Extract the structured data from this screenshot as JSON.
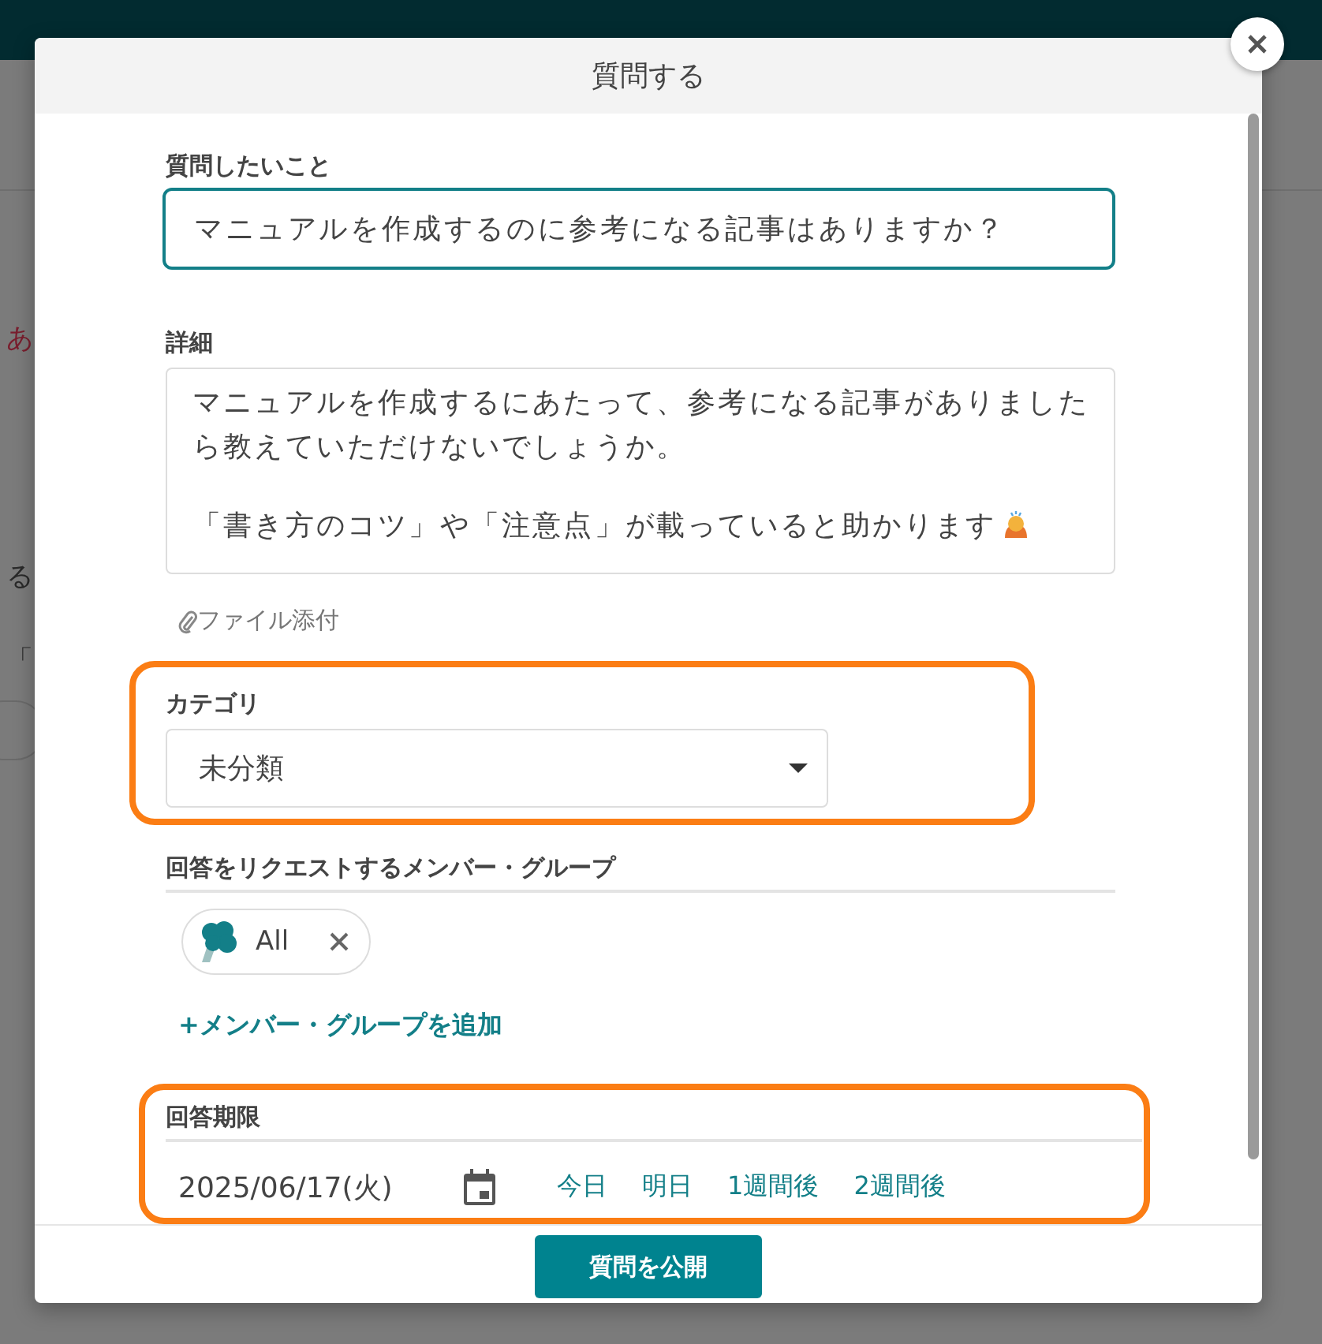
{
  "background": {
    "snippets": [
      {
        "text": "あ",
        "kind": "link"
      },
      {
        "text": "る",
        "kind": "body"
      },
      {
        "text": "「",
        "kind": "quote"
      }
    ]
  },
  "dialog": {
    "title": "質問する",
    "question": {
      "label": "質問したいこと",
      "value": "マニュアルを作成するのに参考になる記事はありますか？",
      "focused": true
    },
    "details": {
      "label": "詳細",
      "paragraphs": [
        "マニュアルを作成するにあたって、参考になる記事がありましたら教えていただけないでしょうか。",
        "「書き方のコツ」や「注意点」が載っていると助かります"
      ]
    },
    "attachment": "ファイル添付",
    "category": {
      "label": "カテゴリ",
      "value": "未分類",
      "highlighted": true
    },
    "members": {
      "label": "回答をリクエストするメンバー・グループ",
      "chips": [
        {
          "name": "All"
        }
      ],
      "add": "+メンバー・グループを追加"
    },
    "deadline": {
      "label": "回答期限",
      "date": "2025/06/17(火)",
      "shortcuts": [
        "今日",
        "明日",
        "1週間後",
        "2週間後"
      ],
      "highlighted": true
    },
    "submit": "質問を公開"
  }
}
